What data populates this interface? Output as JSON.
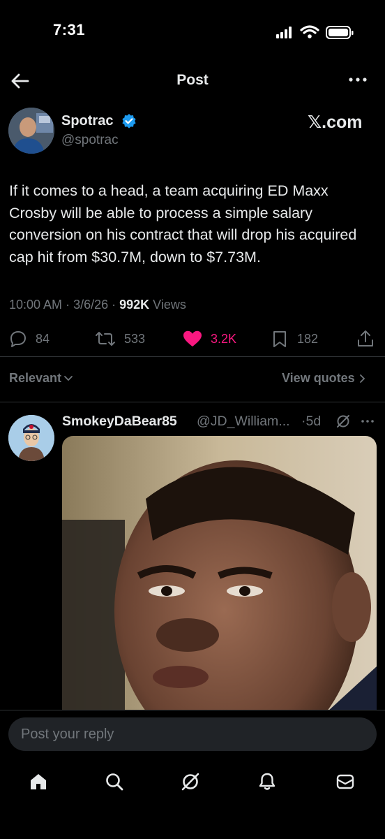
{
  "status_bar": {
    "time": "7:31"
  },
  "header": {
    "title": "Post"
  },
  "post": {
    "author_name": "Spotrac",
    "author_handle": "@spotrac",
    "source_label": "𝕏.com",
    "text": "If it comes to a head, a team acquiring ED Maxx Crosby will be able to process a simple salary conversion on his contract that will drop his acquired cap hit from $30.7M, down to $7.73M.",
    "time": "10:00 AM",
    "date": "3/6/26",
    "views_count": "992K",
    "views_label": "Views",
    "replies": "84",
    "reposts": "533",
    "likes": "3.2K",
    "bookmarks": "182"
  },
  "sort": {
    "relevant_label": "Relevant",
    "view_quotes_label": "View quotes"
  },
  "reply": {
    "author_name": "SmokeyDaBear85",
    "author_handle": "@JD_William...",
    "time": "·5d"
  },
  "composer": {
    "placeholder": "Post your reply"
  },
  "colors": {
    "background": "#000000",
    "text": "#e7e9ea",
    "muted": "#71767b",
    "like": "#f91880",
    "verified": "#1d9bf0"
  },
  "icons": [
    "back-arrow-icon",
    "more-icon",
    "verified-badge-icon",
    "reply-icon",
    "repost-icon",
    "heart-icon",
    "bookmark-icon",
    "share-icon",
    "chevron-down-icon",
    "chevron-right-icon",
    "grok-icon",
    "home-icon",
    "search-icon",
    "notifications-icon",
    "messages-icon"
  ]
}
